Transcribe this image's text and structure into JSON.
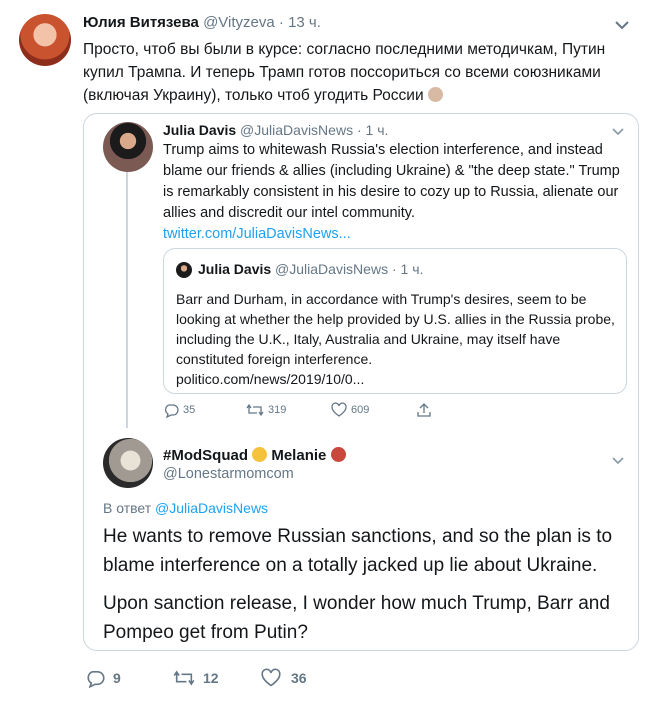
{
  "author": {
    "name": "Юлия Витязева",
    "handle": "@Vityzeva",
    "separator": "·",
    "time": "13 ч.",
    "text": "Просто, чтоб вы были в курсе: согласно последними методичкам, Путин купил Трампа. И теперь Трамп готов поссориться со всеми союзниками (включая Украину), только чтоб угодить России"
  },
  "quoted": {
    "name": "Julia Davis",
    "handle": "@JuliaDavisNews",
    "time": "· 1 ч.",
    "text": "Trump aims to whitewash Russia's election interference, and instead blame our friends & allies (including Ukraine) & \"the deep state.\" Trump is remarkably consistent in his desire to cozy up to Russia, alienate our allies and discredit our intel community.",
    "link": "twitter.com/JuliaDavisNews...",
    "inner": {
      "name": "Julia Davis",
      "handle": "@JuliaDavisNews",
      "time": "· 1 ч.",
      "text": "Barr and Durham, in accordance with Trump's desires, seem to be looking at whether the help provided by U.S. allies in the Russia probe, including the U.K., Italy, Australia and Ukraine, may itself have constituted foreign interference.",
      "link": "politico.com/news/2019/10/0..."
    },
    "stats": {
      "replies": "35",
      "retweets": "319",
      "likes": "609"
    }
  },
  "reply": {
    "name": "#ModSquad",
    "name2": "Melanie",
    "handle": "@Lonestarmomcom",
    "reply_prefix": "В ответ",
    "reply_to": "@JuliaDavisNews",
    "text1": "He wants to remove Russian sanctions,  and so the plan is to blame interference on a totally jacked up lie about Ukraine.",
    "text2": "Upon sanction release, I wonder how much Trump, Barr and Pompeo get from Putin?"
  },
  "stats": {
    "replies": "9",
    "retweets": "12",
    "likes": "36"
  },
  "icons": {
    "caret": "chevron-down-icon",
    "reply": "reply-icon",
    "retweet": "retweet-icon",
    "like": "heart-icon",
    "share": "share-icon"
  },
  "colors": {
    "link": "#1da1f2",
    "muted": "#657786",
    "border": "#ccd6dd"
  }
}
